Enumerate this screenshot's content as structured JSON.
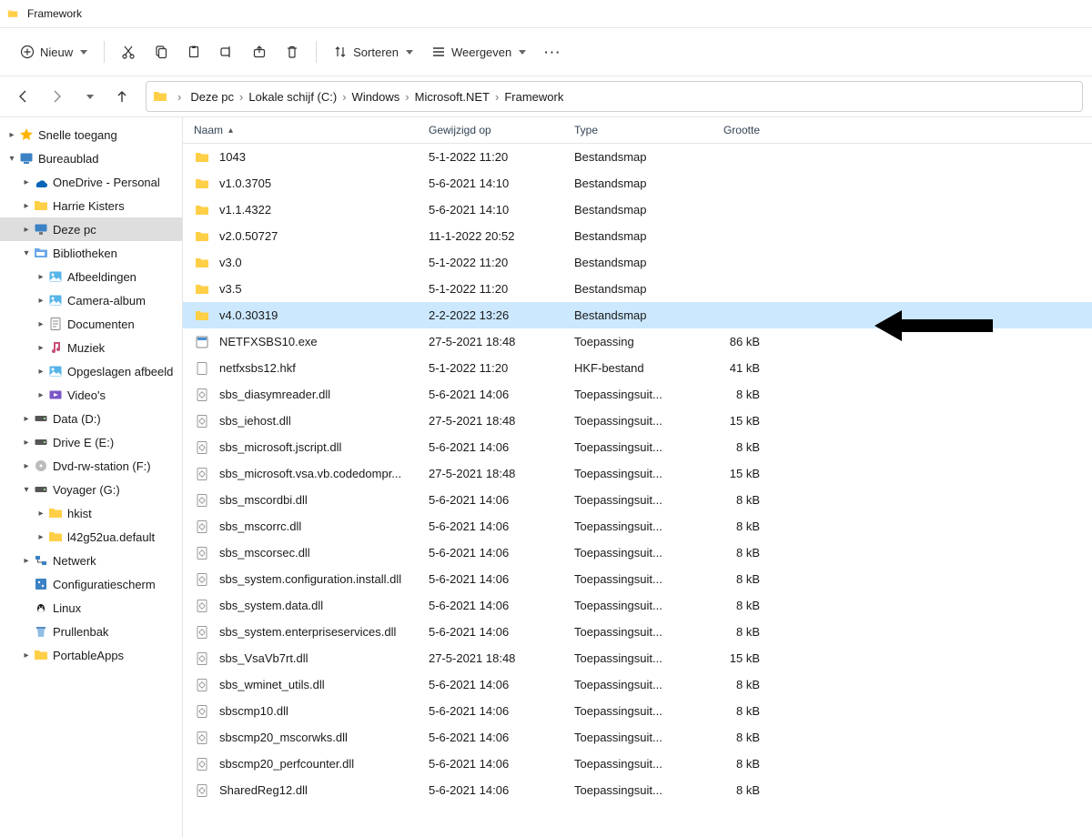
{
  "window": {
    "title": "Framework"
  },
  "toolbar": {
    "new": "Nieuw",
    "sort": "Sorteren",
    "view": "Weergeven"
  },
  "breadcrumbs": [
    "Deze pc",
    "Lokale schijf (C:)",
    "Windows",
    "Microsoft.NET",
    "Framework"
  ],
  "columns": {
    "name": "Naam",
    "date": "Gewijzigd op",
    "type": "Type",
    "size": "Grootte"
  },
  "tree": [
    {
      "d": 0,
      "tw": ">",
      "icon": "star",
      "label": "Snelle toegang",
      "sel": false
    },
    {
      "d": 0,
      "tw": "v",
      "icon": "desktop",
      "label": "Bureaublad",
      "sel": false
    },
    {
      "d": 1,
      "tw": ">",
      "icon": "onedrive",
      "label": "OneDrive - Personal",
      "sel": false
    },
    {
      "d": 1,
      "tw": ">",
      "icon": "folder",
      "label": "Harrie Kisters",
      "sel": false
    },
    {
      "d": 1,
      "tw": ">",
      "icon": "pc",
      "label": "Deze pc",
      "sel": true
    },
    {
      "d": 1,
      "tw": "v",
      "icon": "lib",
      "label": "Bibliotheken",
      "sel": false
    },
    {
      "d": 2,
      "tw": ">",
      "icon": "pic",
      "label": "Afbeeldingen",
      "sel": false
    },
    {
      "d": 2,
      "tw": ">",
      "icon": "pic",
      "label": "Camera-album",
      "sel": false
    },
    {
      "d": 2,
      "tw": ">",
      "icon": "doc",
      "label": "Documenten",
      "sel": false
    },
    {
      "d": 2,
      "tw": ">",
      "icon": "music",
      "label": "Muziek",
      "sel": false
    },
    {
      "d": 2,
      "tw": ">",
      "icon": "pic",
      "label": "Opgeslagen afbeeld",
      "sel": false
    },
    {
      "d": 2,
      "tw": ">",
      "icon": "video",
      "label": "Video's",
      "sel": false
    },
    {
      "d": 1,
      "tw": ">",
      "icon": "drive",
      "label": "Data (D:)",
      "sel": false
    },
    {
      "d": 1,
      "tw": ">",
      "icon": "drive",
      "label": "Drive E (E:)",
      "sel": false
    },
    {
      "d": 1,
      "tw": ">",
      "icon": "dvd",
      "label": "Dvd-rw-station (F:)",
      "sel": false
    },
    {
      "d": 1,
      "tw": "v",
      "icon": "drive",
      "label": "Voyager (G:)",
      "sel": false
    },
    {
      "d": 2,
      "tw": ">",
      "icon": "folder",
      "label": "hkist",
      "sel": false
    },
    {
      "d": 2,
      "tw": ">",
      "icon": "folder",
      "label": "l42g52ua.default",
      "sel": false
    },
    {
      "d": 1,
      "tw": ">",
      "icon": "net",
      "label": "Netwerk",
      "sel": false
    },
    {
      "d": 1,
      "tw": "",
      "icon": "config",
      "label": "Configuratiescherm",
      "sel": false
    },
    {
      "d": 1,
      "tw": "",
      "icon": "linux",
      "label": "Linux",
      "sel": false
    },
    {
      "d": 1,
      "tw": "",
      "icon": "trash",
      "label": "Prullenbak",
      "sel": false
    },
    {
      "d": 1,
      "tw": ">",
      "icon": "folder",
      "label": "PortableApps",
      "sel": false
    }
  ],
  "files": [
    {
      "icon": "folder",
      "name": "1043",
      "date": "5-1-2022 11:20",
      "type": "Bestandsmap",
      "size": "",
      "sel": false
    },
    {
      "icon": "folder",
      "name": "v1.0.3705",
      "date": "5-6-2021 14:10",
      "type": "Bestandsmap",
      "size": "",
      "sel": false
    },
    {
      "icon": "folder",
      "name": "v1.1.4322",
      "date": "5-6-2021 14:10",
      "type": "Bestandsmap",
      "size": "",
      "sel": false
    },
    {
      "icon": "folder",
      "name": "v2.0.50727",
      "date": "11-1-2022 20:52",
      "type": "Bestandsmap",
      "size": "",
      "sel": false
    },
    {
      "icon": "folder",
      "name": "v3.0",
      "date": "5-1-2022 11:20",
      "type": "Bestandsmap",
      "size": "",
      "sel": false
    },
    {
      "icon": "folder",
      "name": "v3.5",
      "date": "5-1-2022 11:20",
      "type": "Bestandsmap",
      "size": "",
      "sel": false
    },
    {
      "icon": "folder",
      "name": "v4.0.30319",
      "date": "2-2-2022 13:26",
      "type": "Bestandsmap",
      "size": "",
      "sel": true
    },
    {
      "icon": "exe",
      "name": "NETFXSBS10.exe",
      "date": "27-5-2021 18:48",
      "type": "Toepassing",
      "size": "86 kB",
      "sel": false
    },
    {
      "icon": "file",
      "name": "netfxsbs12.hkf",
      "date": "5-1-2022 11:20",
      "type": "HKF-bestand",
      "size": "41 kB",
      "sel": false
    },
    {
      "icon": "dll",
      "name": "sbs_diasymreader.dll",
      "date": "5-6-2021 14:06",
      "type": "Toepassingsuit...",
      "size": "8 kB",
      "sel": false
    },
    {
      "icon": "dll",
      "name": "sbs_iehost.dll",
      "date": "27-5-2021 18:48",
      "type": "Toepassingsuit...",
      "size": "15 kB",
      "sel": false
    },
    {
      "icon": "dll",
      "name": "sbs_microsoft.jscript.dll",
      "date": "5-6-2021 14:06",
      "type": "Toepassingsuit...",
      "size": "8 kB",
      "sel": false
    },
    {
      "icon": "dll",
      "name": "sbs_microsoft.vsa.vb.codedompr...",
      "date": "27-5-2021 18:48",
      "type": "Toepassingsuit...",
      "size": "15 kB",
      "sel": false
    },
    {
      "icon": "dll",
      "name": "sbs_mscordbi.dll",
      "date": "5-6-2021 14:06",
      "type": "Toepassingsuit...",
      "size": "8 kB",
      "sel": false
    },
    {
      "icon": "dll",
      "name": "sbs_mscorrc.dll",
      "date": "5-6-2021 14:06",
      "type": "Toepassingsuit...",
      "size": "8 kB",
      "sel": false
    },
    {
      "icon": "dll",
      "name": "sbs_mscorsec.dll",
      "date": "5-6-2021 14:06",
      "type": "Toepassingsuit...",
      "size": "8 kB",
      "sel": false
    },
    {
      "icon": "dll",
      "name": "sbs_system.configuration.install.dll",
      "date": "5-6-2021 14:06",
      "type": "Toepassingsuit...",
      "size": "8 kB",
      "sel": false
    },
    {
      "icon": "dll",
      "name": "sbs_system.data.dll",
      "date": "5-6-2021 14:06",
      "type": "Toepassingsuit...",
      "size": "8 kB",
      "sel": false
    },
    {
      "icon": "dll",
      "name": "sbs_system.enterpriseservices.dll",
      "date": "5-6-2021 14:06",
      "type": "Toepassingsuit...",
      "size": "8 kB",
      "sel": false
    },
    {
      "icon": "dll",
      "name": "sbs_VsaVb7rt.dll",
      "date": "27-5-2021 18:48",
      "type": "Toepassingsuit...",
      "size": "15 kB",
      "sel": false
    },
    {
      "icon": "dll",
      "name": "sbs_wminet_utils.dll",
      "date": "5-6-2021 14:06",
      "type": "Toepassingsuit...",
      "size": "8 kB",
      "sel": false
    },
    {
      "icon": "dll",
      "name": "sbscmp10.dll",
      "date": "5-6-2021 14:06",
      "type": "Toepassingsuit...",
      "size": "8 kB",
      "sel": false
    },
    {
      "icon": "dll",
      "name": "sbscmp20_mscorwks.dll",
      "date": "5-6-2021 14:06",
      "type": "Toepassingsuit...",
      "size": "8 kB",
      "sel": false
    },
    {
      "icon": "dll",
      "name": "sbscmp20_perfcounter.dll",
      "date": "5-6-2021 14:06",
      "type": "Toepassingsuit...",
      "size": "8 kB",
      "sel": false
    },
    {
      "icon": "dll",
      "name": "SharedReg12.dll",
      "date": "5-6-2021 14:06",
      "type": "Toepassingsuit...",
      "size": "8 kB",
      "sel": false
    }
  ]
}
